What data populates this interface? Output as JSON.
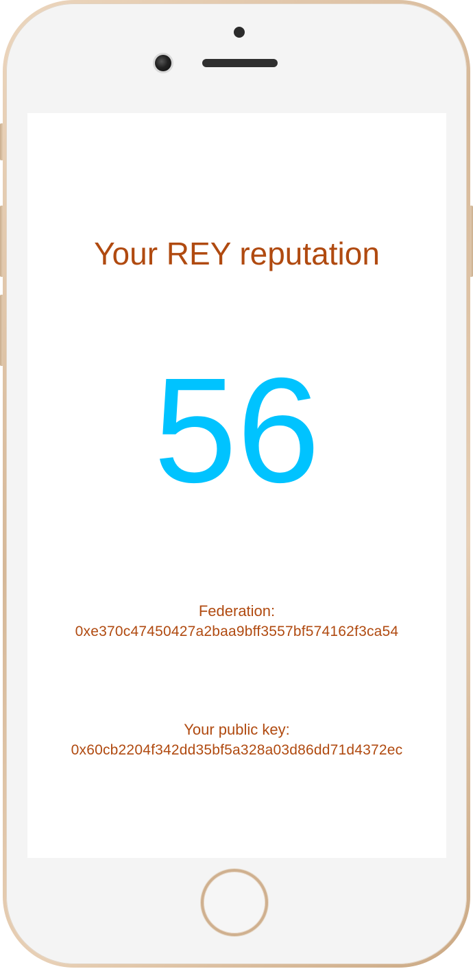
{
  "reputation": {
    "title": "Your REY reputation",
    "score": "56"
  },
  "federation": {
    "label": "Federation:",
    "address": "0xe370c47450427a2baa9bff3557bf574162f3ca54"
  },
  "public_key": {
    "label": "Your public key:",
    "address": "0x60cb2204f342dd35bf5a328a03d86dd71d4372ec"
  },
  "colors": {
    "title": "#b04a10",
    "score": "#00c3ff",
    "frame_gold": "#d6b898"
  }
}
